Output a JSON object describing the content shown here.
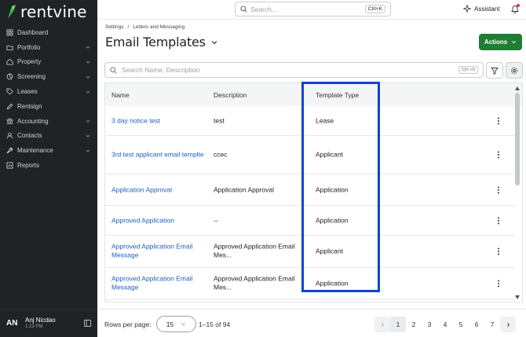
{
  "brand": {
    "name": "rentvine",
    "accent": "#1e7e34"
  },
  "sidebar": {
    "items": [
      {
        "label": "Dashboard",
        "icon": "dashboard-icon",
        "has_children": false
      },
      {
        "label": "Portfolio",
        "icon": "portfolio-icon",
        "has_children": true
      },
      {
        "label": "Property",
        "icon": "home-icon",
        "has_children": true
      },
      {
        "label": "Screening",
        "icon": "screening-icon",
        "has_children": true
      },
      {
        "label": "Leases",
        "icon": "tag-icon",
        "has_children": true
      },
      {
        "label": "Rentsign",
        "icon": "pen-icon",
        "has_children": false
      },
      {
        "label": "Accounting",
        "icon": "bank-icon",
        "has_children": true
      },
      {
        "label": "Contacts",
        "icon": "contacts-icon",
        "has_children": true
      },
      {
        "label": "Maintenance",
        "icon": "wrench-icon",
        "has_children": true
      },
      {
        "label": "Reports",
        "icon": "reports-icon",
        "has_children": false
      }
    ],
    "user": {
      "initials": "AN",
      "name": "Anj Nicdao",
      "time": "1:23 PM"
    }
  },
  "topbar": {
    "search_placeholder": "Search...",
    "search_shortcut": "Ctrl+K",
    "assistant_label": "Assistant"
  },
  "header": {
    "breadcrumb": [
      "Settings",
      "/",
      "Letters and Messaging"
    ],
    "title": "Email Templates",
    "actions_label": "Actions"
  },
  "filter": {
    "placeholder": "Search Name, Description",
    "shortcut": "Ctrl +S"
  },
  "table": {
    "columns": [
      "Name",
      "Description",
      "Template Type"
    ],
    "rows": [
      {
        "name": "3 day notice test",
        "description": "test",
        "type": "Lease"
      },
      {
        "name": "3rd test applicant email templte",
        "description": "ccec",
        "type": "Applicant"
      },
      {
        "name": "Application Approval",
        "description": "Application Approval",
        "type": "Application"
      },
      {
        "name": "Approved Application",
        "description": "--",
        "type": "Application"
      },
      {
        "name": "Approved Application Email Message",
        "description": "Approved Application Email Mes...",
        "type": "Applicant"
      },
      {
        "name": "Approved Application Email Message",
        "description": "Approved Application Email Mes...",
        "type": "Application"
      }
    ]
  },
  "footer": {
    "rows_per_page_label": "Rows per page:",
    "rows_per_page_value": "15",
    "range": "1–15 of 94",
    "pages": [
      "1",
      "2",
      "3",
      "4",
      "5",
      "6",
      "7"
    ],
    "current_page": "1"
  }
}
